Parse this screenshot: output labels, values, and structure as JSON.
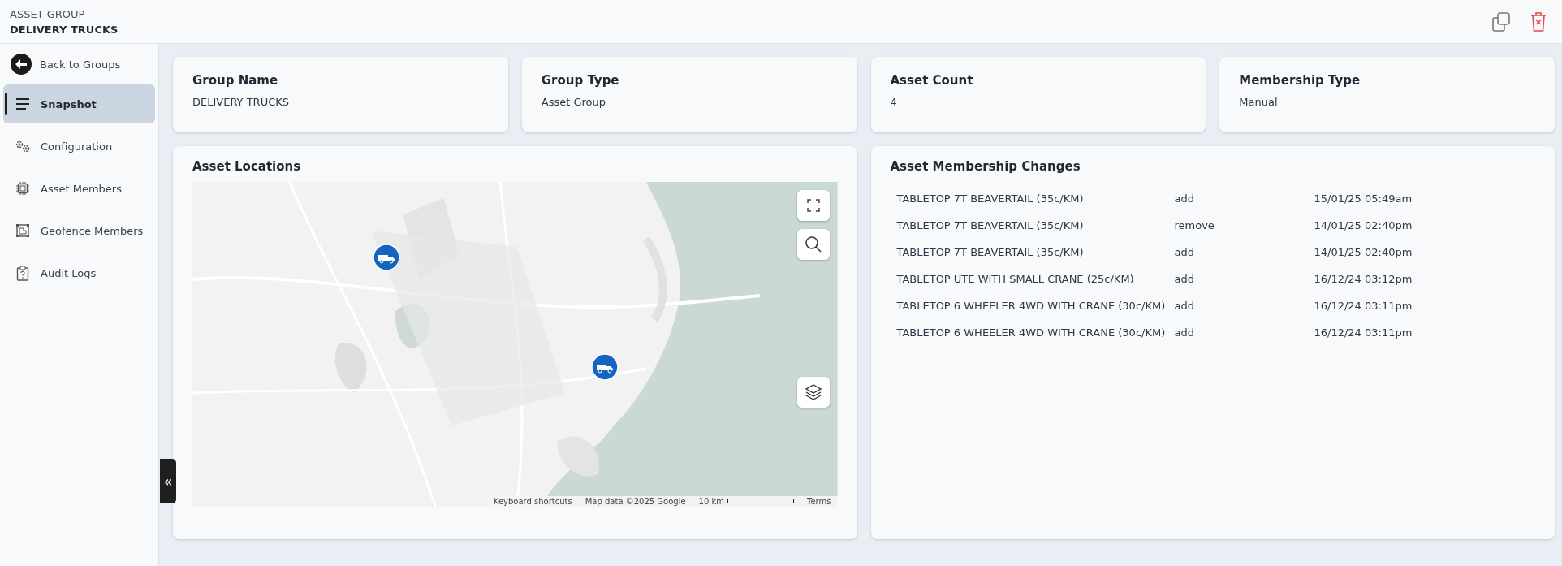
{
  "header": {
    "subtitle": "ASSET GROUP",
    "title": "DELIVERY TRUCKS"
  },
  "sidebar": {
    "back": "Back to Groups",
    "items": [
      {
        "label": "Snapshot",
        "selected": true
      },
      {
        "label": "Configuration",
        "selected": false
      },
      {
        "label": "Asset Members",
        "selected": false
      },
      {
        "label": "Geofence Members",
        "selected": false
      },
      {
        "label": "Audit Logs",
        "selected": false
      }
    ],
    "collapse": "«"
  },
  "summary": [
    {
      "label": "Group Name",
      "value": "DELIVERY TRUCKS"
    },
    {
      "label": "Group Type",
      "value": "Asset Group"
    },
    {
      "label": "Asset Count",
      "value": "4"
    },
    {
      "label": "Membership Type",
      "value": "Manual"
    }
  ],
  "map": {
    "title": "Asset Locations",
    "kind": "picture",
    "footer": [
      "Keyboard shortcuts",
      "Map data ©2025 Google",
      "10 km",
      "Terms"
    ]
  },
  "changes": {
    "title": "Asset Membership Changes",
    "rows": [
      {
        "asset": "TABLETOP 7T BEAVERTAIL (35c/KM)",
        "action": "add",
        "time": "15/01/25 05:49am"
      },
      {
        "asset": "TABLETOP 7T BEAVERTAIL (35c/KM)",
        "action": "remove",
        "time": "14/01/25 02:40pm"
      },
      {
        "asset": "TABLETOP 7T BEAVERTAIL (35c/KM)",
        "action": "add",
        "time": "14/01/25 02:40pm"
      },
      {
        "asset": "TABLETOP UTE WITH SMALL CRANE (25c/KM)",
        "action": "add",
        "time": "16/12/24 03:12pm"
      },
      {
        "asset": "TABLETOP 6 WHEELER 4WD WITH CRANE (30c/KM)",
        "action": "add",
        "time": "16/12/24 03:11pm"
      },
      {
        "asset": "TABLETOP 6 WHEELER 4WD WITH CRANE (30c/KM)",
        "action": "add",
        "time": "16/12/24 03:11pm"
      }
    ]
  }
}
